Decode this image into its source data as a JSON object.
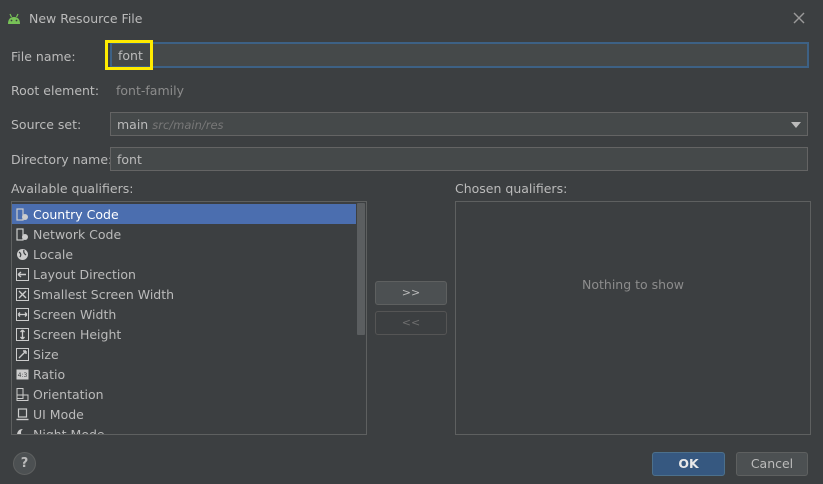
{
  "window": {
    "title": "New Resource File"
  },
  "form": {
    "file_name_label": "File name:",
    "file_name_value": "font",
    "root_element_label": "Root element:",
    "root_element_value": "font-family",
    "source_set_label": "Source set:",
    "source_set_value": "main",
    "source_set_hint": "src/main/res",
    "directory_name_label": "Directory name:",
    "directory_name_value": "font"
  },
  "qualifiers": {
    "available_label": "Available qualifiers:",
    "chosen_label": "Chosen qualifiers:",
    "chosen_empty": "Nothing to show",
    "items": [
      {
        "label": "Country Code",
        "icon": "country-code-icon",
        "selected": true
      },
      {
        "label": "Network Code",
        "icon": "network-code-icon",
        "selected": false
      },
      {
        "label": "Locale",
        "icon": "globe-icon",
        "selected": false
      },
      {
        "label": "Layout Direction",
        "icon": "layout-direction-icon",
        "selected": false
      },
      {
        "label": "Smallest Screen Width",
        "icon": "smallest-width-icon",
        "selected": false
      },
      {
        "label": "Screen Width",
        "icon": "screen-width-icon",
        "selected": false
      },
      {
        "label": "Screen Height",
        "icon": "screen-height-icon",
        "selected": false
      },
      {
        "label": "Size",
        "icon": "size-icon",
        "selected": false
      },
      {
        "label": "Ratio",
        "icon": "ratio-icon",
        "selected": false
      },
      {
        "label": "Orientation",
        "icon": "orientation-icon",
        "selected": false
      },
      {
        "label": "UI Mode",
        "icon": "ui-mode-icon",
        "selected": false
      },
      {
        "label": "Night Mode",
        "icon": "night-mode-icon",
        "selected": false
      }
    ],
    "add_button": ">>",
    "remove_button": "<<"
  },
  "buttons": {
    "ok": "OK",
    "cancel": "Cancel",
    "help": "?"
  },
  "colors": {
    "highlight": "#ffeb00",
    "selection": "#4b6eaf",
    "accent": "#365880"
  }
}
